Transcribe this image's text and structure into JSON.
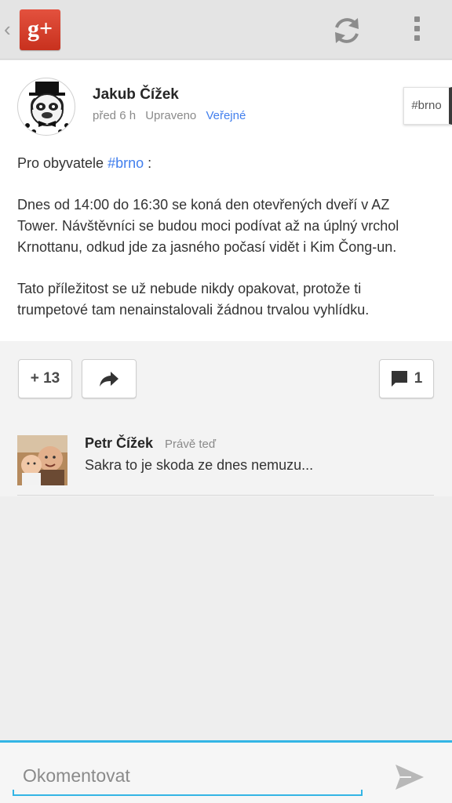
{
  "app": {
    "back_icon": "chevron-left-icon",
    "logo_label": "g+",
    "refresh_icon": "refresh-icon",
    "overflow_icon": "overflow-menu-icon"
  },
  "post": {
    "author": "Jakub Čížek",
    "time": "před 6 h",
    "edited": "Upraveno",
    "visibility": "Veřejné",
    "hashtag_chip": "#brno",
    "intro_prefix": "Pro obyvatele",
    "intro_tag": "#brno",
    "intro_suffix": ":",
    "paragraph_2": "Dnes od 14:00 do 16:30 se koná den otevřených dveří v AZ Tower. Návštěvníci se budou moci podívat až na úplný vrchol Krnottanu, odkud jde za jasného počasí vidět i Kim Čong-un.",
    "paragraph_3": "Tato příležitost se už nebude nikdy opakovat, protože ti trumpetové tam nenainstalovali žádnou trvalou vyhlídku."
  },
  "actions": {
    "plus_count": "+ 13",
    "share_icon": "share-icon",
    "comment_icon": "comment-icon",
    "comment_count": "1"
  },
  "comments": [
    {
      "author": "Petr Čížek",
      "time": "Právě teď",
      "text": "Sakra to je skoda ze dnes nemuzu..."
    }
  ],
  "composer": {
    "placeholder": "Okomentovat",
    "send_icon": "send-icon"
  },
  "colors": {
    "accent": "#33b5e5",
    "link": "#427fed",
    "gplus_red": "#d6412b"
  }
}
